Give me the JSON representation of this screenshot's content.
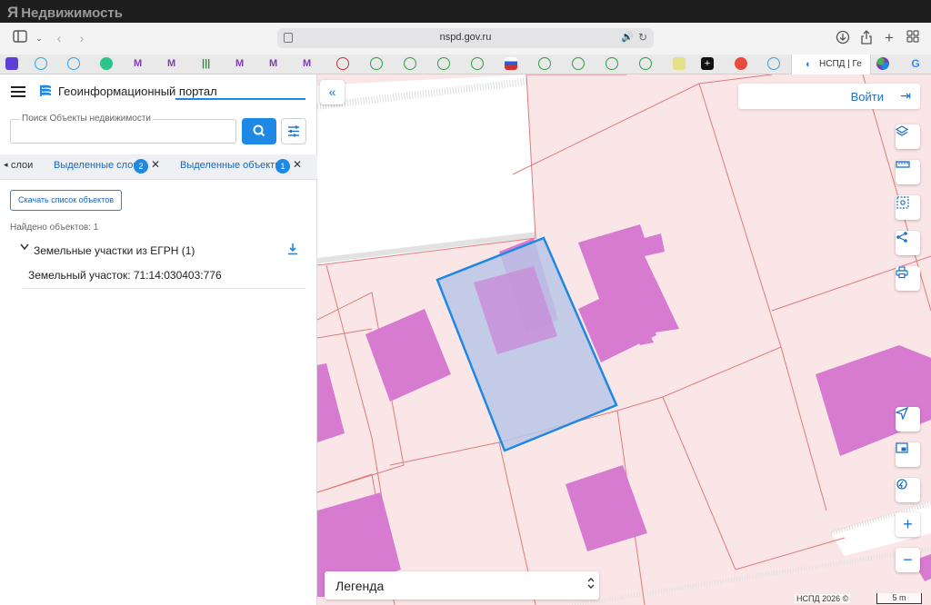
{
  "watermark": {
    "logo_text": "Недвижимость",
    "logo_mark": "Я"
  },
  "browser": {
    "url": "nspd.gov.ru",
    "active_tab_title": "НСПД | Ге"
  },
  "panel": {
    "portal_title": "Геоинформационный портал",
    "search_placeholder": "Поиск Объекты недвижимости",
    "tabs": [
      {
        "label": "слои"
      },
      {
        "label": "Выделенные слои",
        "badge": "2"
      },
      {
        "label": "Выделенные объекты",
        "badge": "1"
      }
    ],
    "download_list_label": "Скачать список объектов",
    "found_text": "Найдено объектов: 1",
    "group_title": "Земельные участки из ЕГРН (1)",
    "item_label": "Земельный участок: 71:14:030403:776"
  },
  "map": {
    "login_label": "Войти",
    "legend_label": "Легенда",
    "attribution": "НСПД 2026 ©",
    "scale_label": "5 m",
    "colors": {
      "parcel_fill": "#fbe6e7",
      "parcel_line": "#e07a7a",
      "building": "#d77bd1",
      "road": "#ffffff",
      "selection_stroke": "#1e88e5",
      "selection_fill": "#b9c6e6"
    }
  }
}
